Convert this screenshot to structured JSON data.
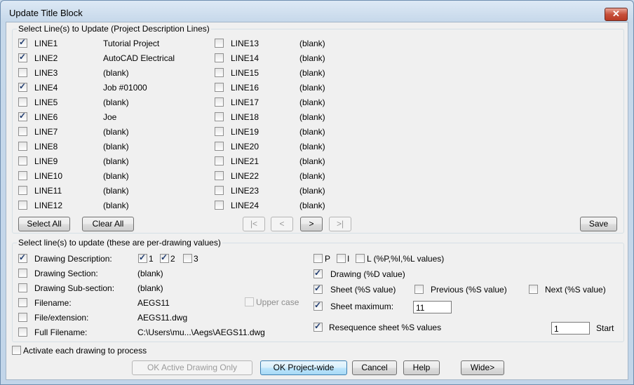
{
  "window": {
    "title": "Update Title Block",
    "close_label": "✕"
  },
  "project_group": {
    "label": "Select Line(s) to Update (Project Description Lines)",
    "left_lines": [
      {
        "name": "LINE1",
        "value": "Tutorial Project",
        "checked": true
      },
      {
        "name": "LINE2",
        "value": "AutoCAD Electrical",
        "checked": true
      },
      {
        "name": "LINE3",
        "value": "(blank)",
        "checked": false
      },
      {
        "name": "LINE4",
        "value": "Job #01000",
        "checked": true
      },
      {
        "name": "LINE5",
        "value": "(blank)",
        "checked": false
      },
      {
        "name": "LINE6",
        "value": "Joe",
        "checked": true
      },
      {
        "name": "LINE7",
        "value": "(blank)",
        "checked": false
      },
      {
        "name": "LINE8",
        "value": "(blank)",
        "checked": false
      },
      {
        "name": "LINE9",
        "value": "(blank)",
        "checked": false
      },
      {
        "name": "LINE10",
        "value": "(blank)",
        "checked": false
      },
      {
        "name": "LINE11",
        "value": "(blank)",
        "checked": false
      },
      {
        "name": "LINE12",
        "value": "(blank)",
        "checked": false
      }
    ],
    "right_lines": [
      {
        "name": "LINE13",
        "value": "(blank)",
        "checked": false
      },
      {
        "name": "LINE14",
        "value": "(blank)",
        "checked": false
      },
      {
        "name": "LINE15",
        "value": "(blank)",
        "checked": false
      },
      {
        "name": "LINE16",
        "value": "(blank)",
        "checked": false
      },
      {
        "name": "LINE17",
        "value": "(blank)",
        "checked": false
      },
      {
        "name": "LINE18",
        "value": "(blank)",
        "checked": false
      },
      {
        "name": "LINE19",
        "value": "(blank)",
        "checked": false
      },
      {
        "name": "LINE20",
        "value": "(blank)",
        "checked": false
      },
      {
        "name": "LINE21",
        "value": "(blank)",
        "checked": false
      },
      {
        "name": "LINE22",
        "value": "(blank)",
        "checked": false
      },
      {
        "name": "LINE23",
        "value": "(blank)",
        "checked": false
      },
      {
        "name": "LINE24",
        "value": "(blank)",
        "checked": false
      }
    ],
    "select_all": "Select All",
    "clear_all": "Clear All",
    "nav_first": "|<",
    "nav_prev": "<",
    "nav_next": ">",
    "nav_last": ">|",
    "save": "Save"
  },
  "drawing_group": {
    "label": "Select line(s) to update (these are per-drawing values)",
    "rows": [
      {
        "label": "Drawing Description:",
        "value": "",
        "checked": true
      },
      {
        "label": "Drawing Section:",
        "value": "(blank)",
        "checked": false
      },
      {
        "label": "Drawing Sub-section:",
        "value": "(blank)",
        "checked": false
      },
      {
        "label": "Filename:",
        "value": "AEGS11",
        "checked": false
      },
      {
        "label": "File/extension:",
        "value": "AEGS11.dwg",
        "checked": false
      },
      {
        "label": "Full Filename:",
        "value": "C:\\Users\\mu...\\Aegs\\AEGS11.dwg",
        "checked": false
      }
    ],
    "desc_options": [
      {
        "label": "1",
        "checked": true
      },
      {
        "label": "2",
        "checked": true
      },
      {
        "label": "3",
        "checked": false
      }
    ],
    "upper_case": "Upper case",
    "pil": [
      {
        "label": "P",
        "checked": false
      },
      {
        "label": "I",
        "checked": false
      },
      {
        "label": "L (%P,%I,%L values)",
        "checked": false
      }
    ],
    "drawing_d": {
      "label": "Drawing (%D value)",
      "checked": true
    },
    "sheet_s": {
      "label": "Sheet (%S value)",
      "checked": true
    },
    "previous_s": {
      "label": "Previous (%S value)",
      "checked": false
    },
    "next_s": {
      "label": "Next (%S value)",
      "checked": false
    },
    "sheet_max": {
      "label": "Sheet maximum:",
      "checked": true,
      "value": "11"
    },
    "resequence": {
      "label": "Resequence sheet %S values",
      "checked": true,
      "value": "1",
      "start_label": "Start"
    }
  },
  "activate_each": {
    "label": "Activate each drawing to process",
    "checked": false
  },
  "buttons": {
    "ok_active": "OK Active Drawing Only",
    "ok_project": "OK Project-wide",
    "cancel": "Cancel",
    "help": "Help",
    "wide": "Wide>"
  }
}
